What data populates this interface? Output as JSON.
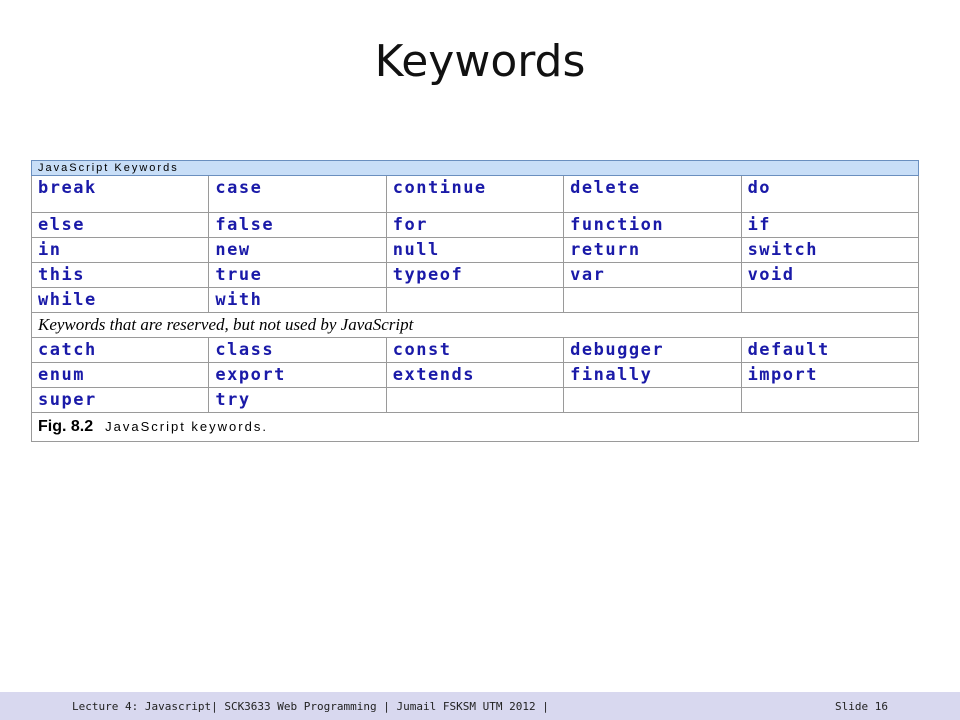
{
  "slide": {
    "title": "Keywords",
    "footer_left": "Lecture 4: Javascript| SCK3633 Web Programming | Jumail FSKSM UTM 2012 |",
    "footer_right": "Slide 16"
  },
  "table": {
    "header": "JavaScript Keywords",
    "rows": [
      [
        "break",
        "case",
        "continue",
        "delete",
        "do"
      ],
      [
        "else",
        "false",
        "for",
        "function",
        "if"
      ],
      [
        "in",
        "new",
        "null",
        "return",
        "switch"
      ],
      [
        "this",
        "true",
        "typeof",
        "var",
        "void"
      ],
      [
        "while",
        "with",
        "",
        "",
        ""
      ]
    ],
    "reserved_label": "Keywords that are reserved, but not used by JavaScript",
    "reserved_rows": [
      [
        "catch",
        "class",
        "const",
        "debugger",
        "default"
      ],
      [
        "enum",
        "export",
        "extends",
        "finally",
        "import"
      ],
      [
        "super",
        "try",
        "",
        "",
        ""
      ]
    ],
    "caption_fig": "Fig. 8.2",
    "caption_text": "JavaScript keywords."
  }
}
